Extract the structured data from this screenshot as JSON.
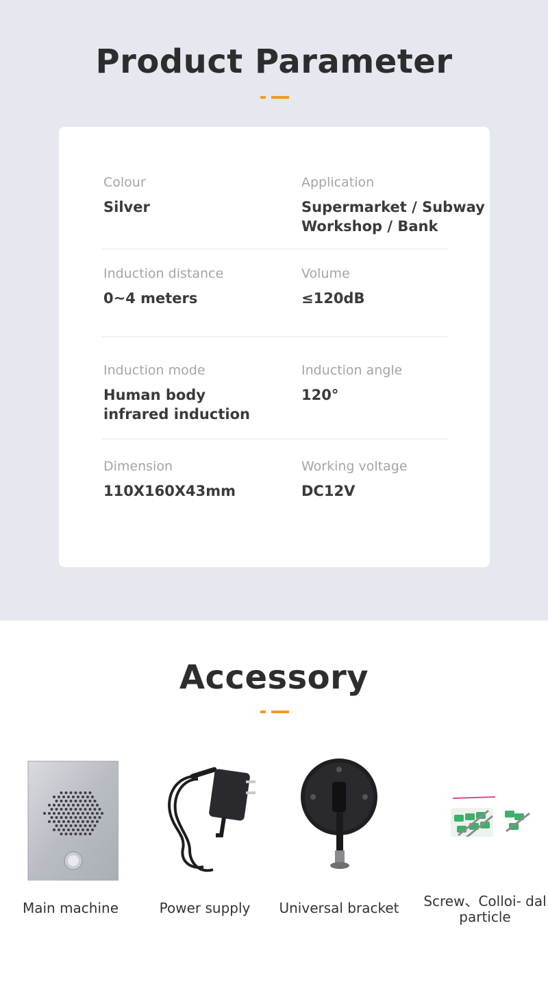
{
  "params": {
    "title": "Product Parameter",
    "rows": [
      {
        "left": {
          "label": "Colour",
          "value": "Silver"
        },
        "right": {
          "label": "Application",
          "value": "Supermarket / Subway\nWorkshop / Bank"
        }
      },
      {
        "left": {
          "label": "Induction distance",
          "value": "0~4 meters"
        },
        "right": {
          "label": "Volume",
          "value": "≤120dB"
        }
      },
      {
        "left": {
          "label": "Induction mode",
          "value": "Human body\ninfrared induction"
        },
        "right": {
          "label": "Induction angle",
          "value": "120°"
        }
      },
      {
        "left": {
          "label": "Dimension",
          "value": "110X160X43mm"
        },
        "right": {
          "label": "Working voltage",
          "value": "DC12V"
        }
      }
    ]
  },
  "accessory": {
    "title": "Accessory",
    "items": [
      {
        "label": "Main machine"
      },
      {
        "label": "Power supply"
      },
      {
        "label": "Universal bracket"
      },
      {
        "label": "Screw、Colloi-\ndal particle"
      }
    ]
  },
  "colors": {
    "accent": "#f39a1e",
    "background": "#e5e8ef"
  }
}
